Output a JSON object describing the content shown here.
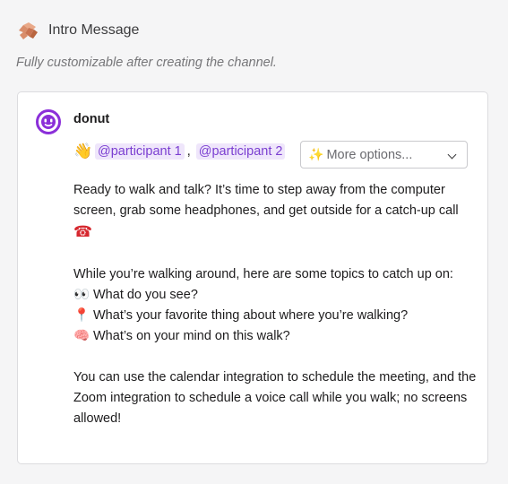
{
  "header": {
    "icon": "handshake-icon",
    "title": "Intro Message"
  },
  "subtitle": "Fully customizable after creating the channel.",
  "message": {
    "sender": "donut",
    "sender_icon": "donut-avatar-icon",
    "mentions": [
      "@participant 1",
      "@participant 2"
    ],
    "mention_separator": ",",
    "wave_emoji": "👋",
    "options_select": {
      "emoji": "✨",
      "label": "More options..."
    },
    "paragraph1": "Ready to walk and talk? It’s time to step away from the computer screen, grab some headphones, and get outside for a catch-up call",
    "phone_emoji": "☎",
    "topics_intro": "While you’re walking around, here are some topics to catch up on:",
    "topics": [
      {
        "emoji": "👀",
        "text": "What do you see?"
      },
      {
        "emoji": "📍",
        "text": "What’s your favorite thing about where you’re walking?"
      },
      {
        "emoji": "🧠",
        "text": "What’s on your mind on this walk?"
      }
    ],
    "paragraph3": "You can use the calendar integration to schedule the meeting, and the Zoom integration to schedule a voice call while you walk; no screens allowed!"
  },
  "colors": {
    "background": "#f5f5f6",
    "mention_bg": "#efe6fb",
    "mention_text": "#7b3fd1",
    "avatar": "#8b2fd9"
  }
}
